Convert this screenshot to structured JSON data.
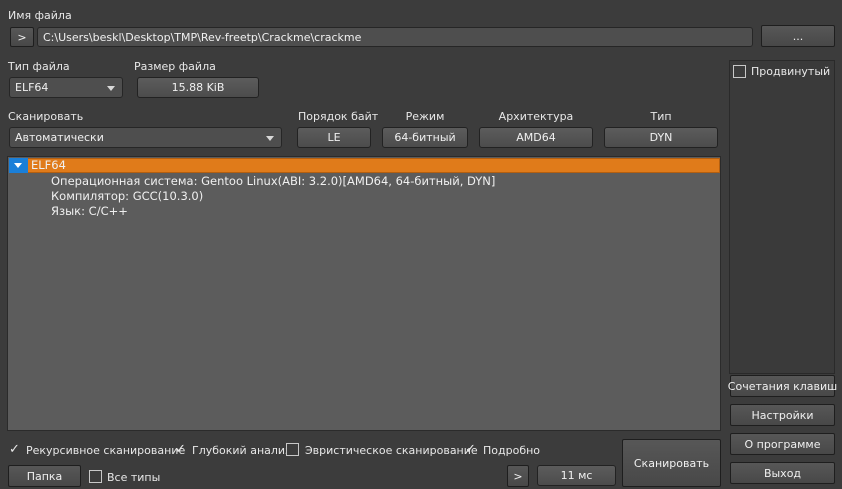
{
  "file": {
    "label": "Имя файла",
    "path": "C:\\Users\\beskl\\Desktop\\TMP\\Rev-freetp\\Crackme\\crackme",
    "go_label": ">",
    "browse_label": "..."
  },
  "file_type": {
    "label": "Тип файла",
    "value": "ELF64"
  },
  "file_size": {
    "label": "Размер файла",
    "value": "15.88 KiB"
  },
  "scan": {
    "label": "Сканировать",
    "value": "Автоматически"
  },
  "props": [
    {
      "label": "Порядок байт",
      "value": "LE"
    },
    {
      "label": "Режим",
      "value": "64-битный"
    },
    {
      "label": "Архитектура",
      "value": "AMD64"
    },
    {
      "label": "Тип",
      "value": "DYN"
    }
  ],
  "advanced": {
    "label": "Продвинутый",
    "checked": false
  },
  "results": {
    "root": "ELF64",
    "children": [
      "Операционная система: Gentoo Linux(ABI: 3.2.0)[AMD64, 64-битный, DYN]",
      "Компилятор: GCC(10.3.0)",
      "Язык: C/C++"
    ]
  },
  "options": {
    "recursive": {
      "label": "Рекурсивное сканирование",
      "checked": true
    },
    "deep": {
      "label": "Глубокий анализ",
      "checked": true
    },
    "heuristic": {
      "label": "Эвристическое сканирование",
      "checked": false
    },
    "verbose": {
      "label": "Подробно",
      "checked": true
    },
    "all_types": {
      "label": "Все типы",
      "checked": false
    }
  },
  "bottom": {
    "folder_label": "Папка",
    "next_label": ">",
    "time": "11 мс",
    "scan_label": "Сканировать"
  },
  "side_buttons": {
    "shortcuts": "Сочетания клавиш",
    "settings": "Настройки",
    "about": "О программе",
    "exit": "Выход"
  },
  "colors": {
    "selection": "#e07b1a",
    "expander": "#1a7fd8"
  }
}
